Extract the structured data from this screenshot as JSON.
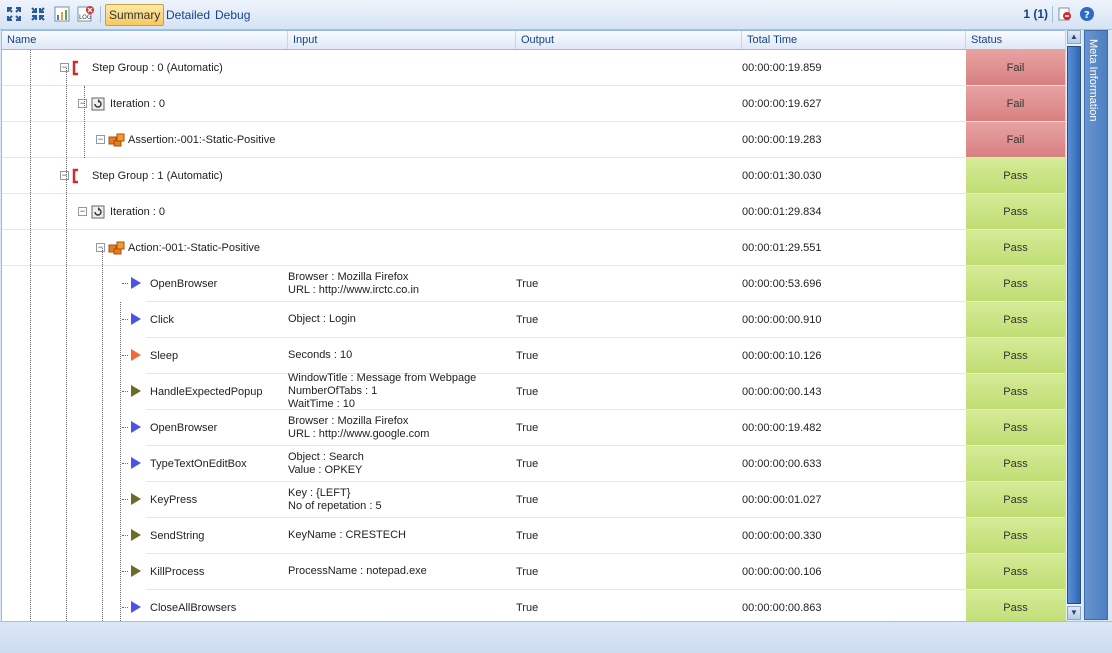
{
  "toolbar": {
    "expand_icon": "expand-all-icon",
    "collapse_icon": "collapse-all-icon",
    "chart_icon": "report-chart-icon",
    "log_icon": "log-icon",
    "tabs": [
      "Summary",
      "Detailed",
      "Debug"
    ],
    "active_tab": "Summary",
    "page_info": "1 (1)"
  },
  "columns": [
    "Name",
    "Input",
    "Output",
    "Total Time",
    "Status"
  ],
  "side_panel_label": "Meta Information",
  "colors": {
    "pass": "#c6e17e",
    "fail": "#dd8b8b",
    "header_text": "#15428b"
  },
  "rows": [
    {
      "name": "Step Group : 0 (Automatic)",
      "type": "group",
      "level": 0,
      "input": [],
      "output": "",
      "time": "00:00:00:19.859",
      "status": "Fail"
    },
    {
      "name": "Iteration : 0",
      "type": "iteration",
      "level": 1,
      "input": [],
      "output": "",
      "time": "00:00:00:19.627",
      "status": "Fail"
    },
    {
      "name": "Assertion:-001:-Static-Positive",
      "type": "assertion",
      "level": 2,
      "input": [],
      "output": "",
      "time": "00:00:00:19.283",
      "status": "Fail"
    },
    {
      "name": "Step Group : 1 (Automatic)",
      "type": "group",
      "level": 0,
      "input": [],
      "output": "",
      "time": "00:00:01:30.030",
      "status": "Pass"
    },
    {
      "name": "Iteration : 0",
      "type": "iteration",
      "level": 1,
      "input": [],
      "output": "",
      "time": "00:00:01:29.834",
      "status": "Pass"
    },
    {
      "name": "Action:-001:-Static-Positive",
      "type": "assertion",
      "level": 2,
      "input": [],
      "output": "",
      "time": "00:00:01:29.551",
      "status": "Pass"
    },
    {
      "name": "OpenBrowser",
      "type": "step-blue",
      "level": 3,
      "input": [
        "Browser : Mozilla Firefox",
        "URL : http://www.irctc.co.in"
      ],
      "output": "True",
      "time": "00:00:00:53.696",
      "status": "Pass"
    },
    {
      "name": "Click",
      "type": "step-blue",
      "level": 3,
      "input": [
        "Object : Login"
      ],
      "output": "True",
      "time": "00:00:00:00.910",
      "status": "Pass"
    },
    {
      "name": "Sleep",
      "type": "step-orange",
      "level": 3,
      "input": [
        "Seconds : 10"
      ],
      "output": "True",
      "time": "00:00:00:10.126",
      "status": "Pass"
    },
    {
      "name": "HandleExpectedPopup",
      "type": "step-olive",
      "level": 3,
      "input": [
        "WindowTitle : Message from Webpage",
        "NumberOfTabs : 1",
        "WaitTime : 10"
      ],
      "output": "True",
      "time": "00:00:00:00.143",
      "status": "Pass"
    },
    {
      "name": "OpenBrowser",
      "type": "step-blue",
      "level": 3,
      "input": [
        "Browser : Mozilla Firefox",
        "URL : http://www.google.com"
      ],
      "output": "True",
      "time": "00:00:00:19.482",
      "status": "Pass"
    },
    {
      "name": "TypeTextOnEditBox",
      "type": "step-blue",
      "level": 3,
      "input": [
        "Object : Search",
        "Value : OPKEY"
      ],
      "output": "True",
      "time": "00:00:00:00.633",
      "status": "Pass"
    },
    {
      "name": "KeyPress",
      "type": "step-olive",
      "level": 3,
      "input": [
        "Key : {LEFT}",
        "No of repetation : 5"
      ],
      "output": "True",
      "time": "00:00:00:01.027",
      "status": "Pass"
    },
    {
      "name": "SendString",
      "type": "step-olive",
      "level": 3,
      "input": [
        "KeyName : CRESTECH"
      ],
      "output": "True",
      "time": "00:00:00:00.330",
      "status": "Pass"
    },
    {
      "name": "KillProcess",
      "type": "step-olive",
      "level": 3,
      "input": [
        "ProcessName : notepad.exe"
      ],
      "output": "True",
      "time": "00:00:00:00.106",
      "status": "Pass"
    },
    {
      "name": "CloseAllBrowsers",
      "type": "step-blue",
      "level": 3,
      "input": [],
      "output": "True",
      "time": "00:00:00:00.863",
      "status": "Pass"
    }
  ]
}
